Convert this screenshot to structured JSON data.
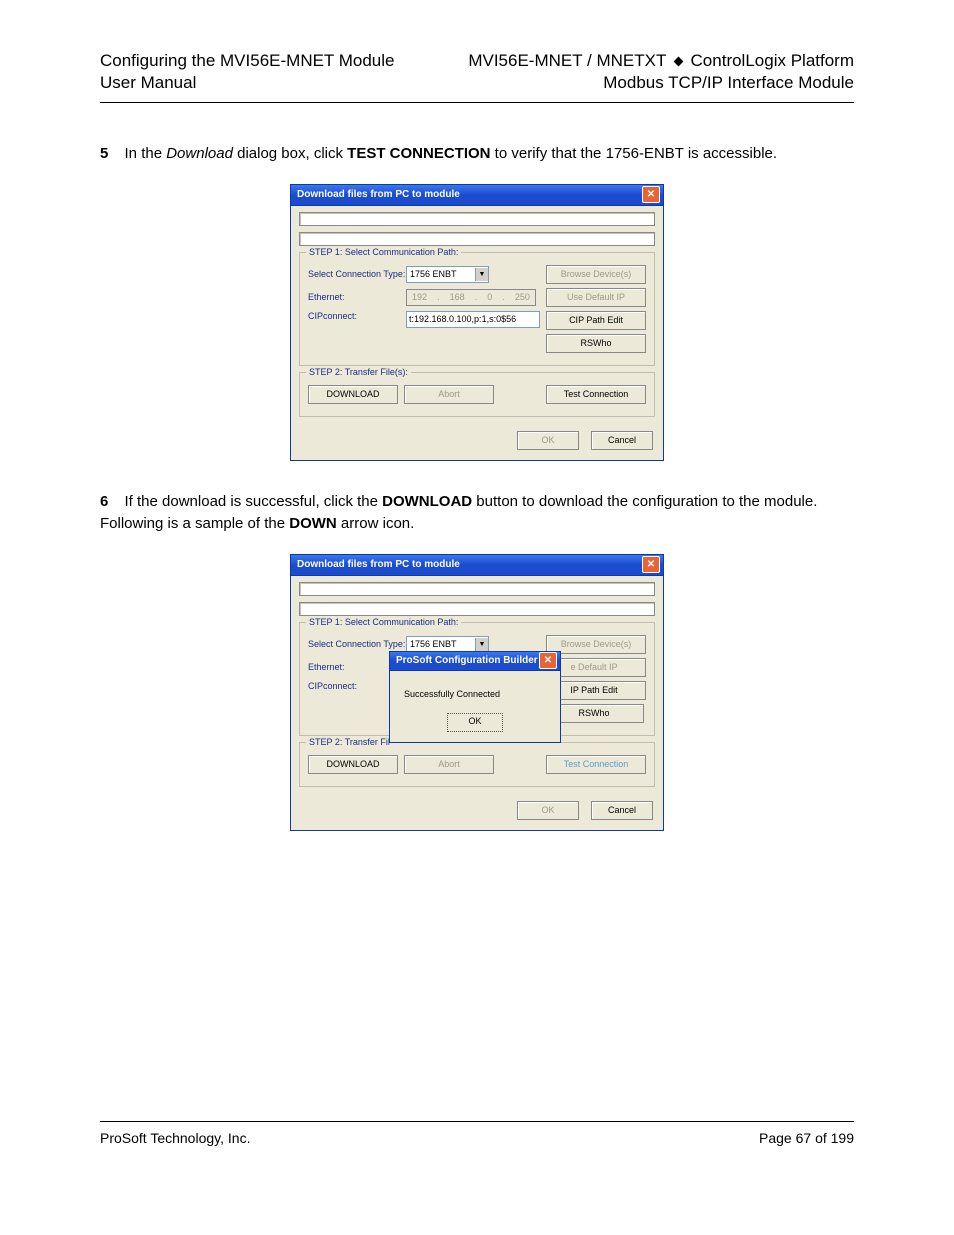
{
  "header": {
    "left_line1": "Configuring the MVI56E-MNET Module",
    "left_line2": "User Manual",
    "right_line1_a": "MVI56E-MNET / MNETXT",
    "right_line1_b": "ControlLogix Platform",
    "right_line2": "Modbus TCP/IP Interface Module"
  },
  "step5_text": "In the Download dialog box, click TEST CONNECTION to verify that the 1756-ENBT is accessible.",
  "step6_text": "If the download is successful, click the DOWNLOAD button to download the configuration to the module. Following is a sample of the DOWN arrow icon.",
  "dialog1": {
    "title": "Download files from PC to module",
    "step1_legend": "STEP 1: Select Communication Path:",
    "conn_type_label": "Select Connection Type:",
    "conn_type_value": "1756 ENBT",
    "browse_btn": "Browse Device(s)",
    "ethernet_label": "Ethernet:",
    "ip": {
      "a": "192",
      "b": "168",
      "c": "0",
      "d": "250"
    },
    "use_default_btn": "Use Default IP",
    "cip_label": "CIPconnect:",
    "cip_value": "t:192.168.0.100,p:1,s:0$56",
    "cip_path_btn": "CIP Path Edit",
    "rswho_btn": "RSWho",
    "step2_legend": "STEP 2: Transfer File(s):",
    "download_btn": "DOWNLOAD",
    "abort_btn": "Abort",
    "test_btn": "Test Connection",
    "ok_btn": "OK",
    "cancel_btn": "Cancel"
  },
  "dialog2": {
    "title": "Download files from PC to module",
    "popup_title": "ProSoft Configuration Builder",
    "popup_msg": "Successfully Connected",
    "popup_ok": "OK"
  },
  "footer": {
    "left": "ProSoft Technology, Inc.",
    "right": "Page 67 of 199"
  }
}
